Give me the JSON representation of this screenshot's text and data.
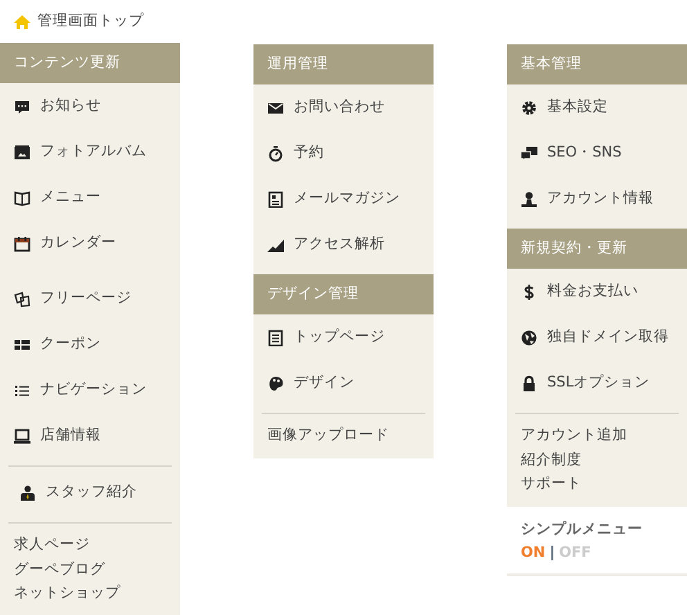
{
  "top_link": {
    "label": "管理画面トップ"
  },
  "columns": [
    {
      "sections": [
        {
          "kind": "header",
          "label": "コンテンツ更新"
        },
        {
          "kind": "menu",
          "divided": false,
          "items": [
            "お知らせ",
            "フォトアルバム",
            "メニュー",
            "カレンダー"
          ]
        },
        {
          "kind": "menu",
          "divided": false,
          "items": [
            "フリーページ",
            "クーポン",
            "ナビゲーション",
            "店舗情報"
          ]
        },
        {
          "kind": "menu",
          "divided": true,
          "items": [
            "スタッフ紹介"
          ]
        },
        {
          "kind": "links",
          "divided": true,
          "items": [
            "求人ページ",
            "グーペブログ",
            "ネットショップ"
          ]
        }
      ]
    },
    {
      "sections": [
        {
          "kind": "header",
          "label": "運用管理"
        },
        {
          "kind": "menu",
          "divided": false,
          "items": [
            "お問い合わせ",
            "予約",
            "メールマガジン",
            "アクセス解析"
          ]
        },
        {
          "kind": "header",
          "label": "デザイン管理"
        },
        {
          "kind": "menu",
          "divided": false,
          "items": [
            "トップページ",
            "デザイン"
          ]
        },
        {
          "kind": "links",
          "divided": true,
          "items": [
            "画像アップロード"
          ]
        }
      ]
    },
    {
      "sections": [
        {
          "kind": "header",
          "label": "基本管理"
        },
        {
          "kind": "menu",
          "divided": false,
          "items": [
            "基本設定",
            "SEO・SNS",
            "アカウント情報"
          ]
        },
        {
          "kind": "header",
          "label": "新規契約・更新"
        },
        {
          "kind": "menu",
          "divided": false,
          "items": [
            "料金お支払い",
            "独自ドメイン取得",
            "SSLオプション"
          ]
        },
        {
          "kind": "links",
          "divided": true,
          "items": [
            "アカウント追加",
            "紹介制度",
            "サポート"
          ]
        },
        {
          "kind": "toggle",
          "title": "シンプルメニュー",
          "separator": "|",
          "options": [
            {
              "label": "ON",
              "selected": true
            },
            {
              "label": "OFF",
              "selected": false
            }
          ]
        }
      ]
    }
  ]
}
